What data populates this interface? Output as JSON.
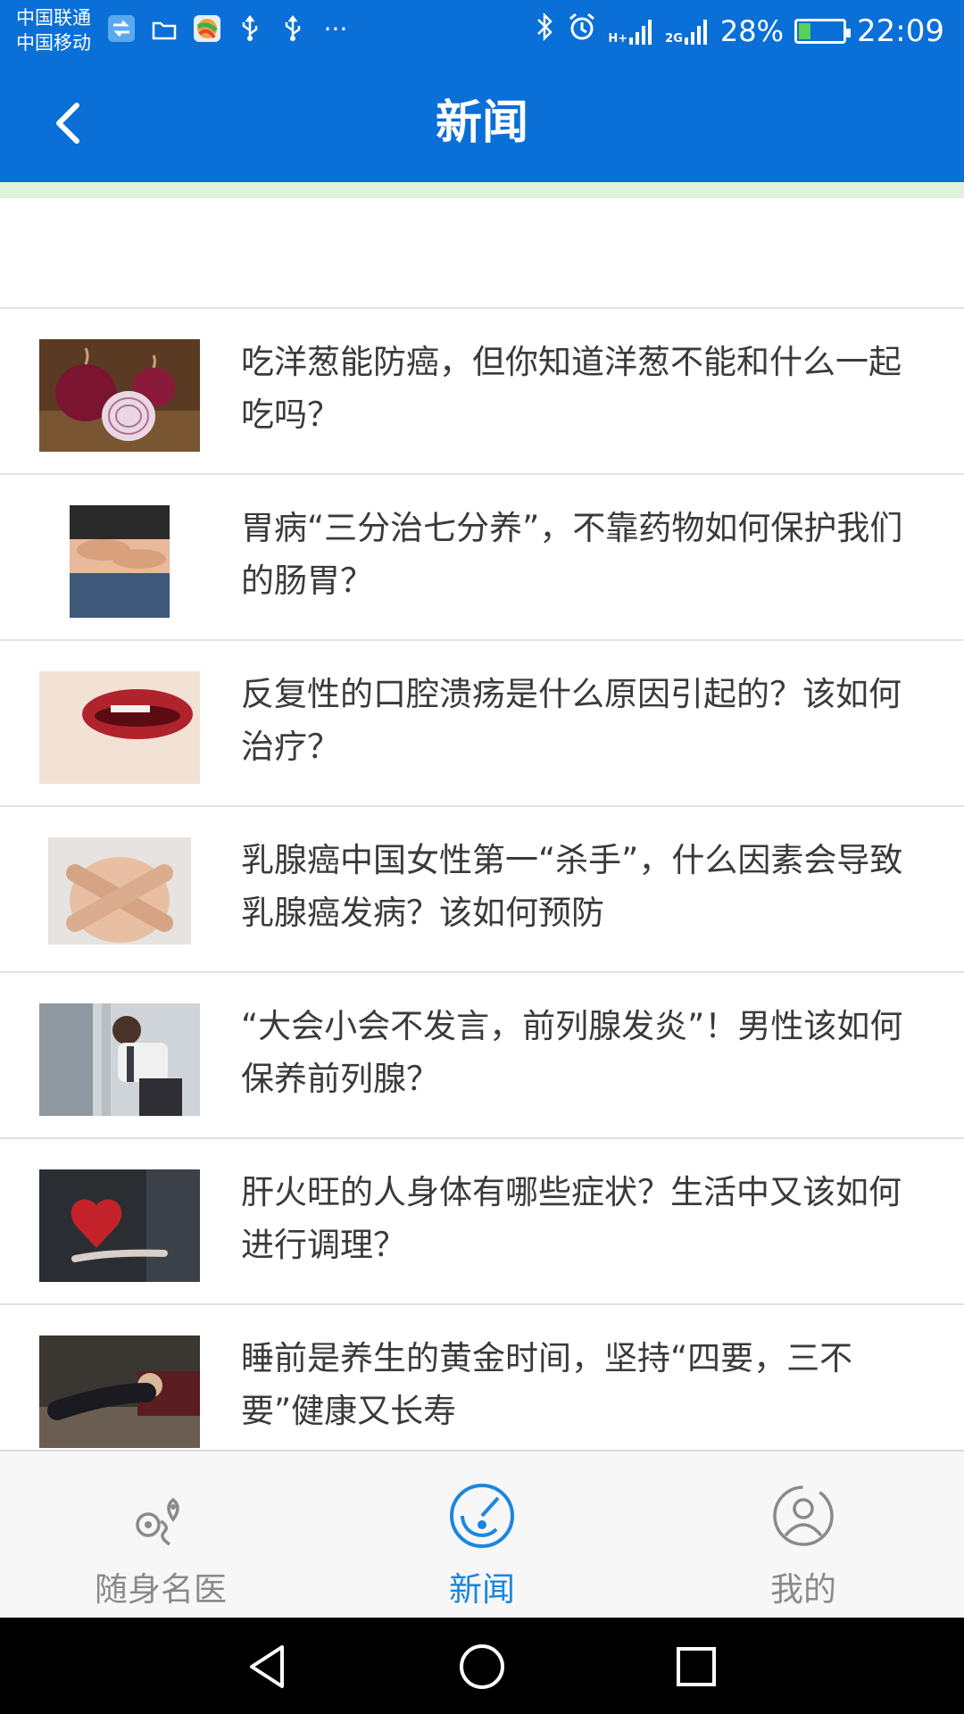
{
  "status_bar": {
    "carrier_1": "中国联通",
    "carrier_2": "中国移动",
    "signal_1": "H+",
    "signal_2": "2G",
    "battery_percent": "28%",
    "battery_level": 0.28,
    "time": "22:09",
    "more": "···"
  },
  "header": {
    "title": "新闻"
  },
  "news": [
    {
      "title": "吃洋葱能防癌，但你知道洋葱不能和什么一起吃吗？",
      "image": "onion-thumbnail"
    },
    {
      "title": "胃病“三分治七分养”，不靠药物如何保护我们的肠胃？",
      "image": "stomach-thumbnail"
    },
    {
      "title": "反复性的口腔溃疡是什么原因引起的？该如何治疗？",
      "image": "mouth-thumbnail"
    },
    {
      "title": "乳腺癌中国女性第一“杀手”，什么因素会导致乳腺癌发病？该如何预防",
      "image": "breast-thumbnail"
    },
    {
      "title": "“大会小会不发言，前列腺发炎”！男性该如何保养前列腺？",
      "image": "man-restroom-thumbnail"
    },
    {
      "title": "肝火旺的人身体有哪些症状？生活中又该如何进行调理？",
      "image": "heart-hand-thumbnail"
    },
    {
      "title": "睡前是养生的黄金时间，坚持“四要，三不要”健康又长寿",
      "image": "sleep-thumbnail"
    }
  ],
  "tabs": [
    {
      "label": "随身名医",
      "icon": "location-pin-icon",
      "active": false
    },
    {
      "label": "新闻",
      "icon": "radar-icon",
      "active": true
    },
    {
      "label": "我的",
      "icon": "user-icon",
      "active": false
    }
  ],
  "colors": {
    "brand_blue": "#0a6fd6",
    "active_tab": "#1a86e0",
    "inactive_tab": "#8a8a8a",
    "text": "#3a3a3a"
  }
}
